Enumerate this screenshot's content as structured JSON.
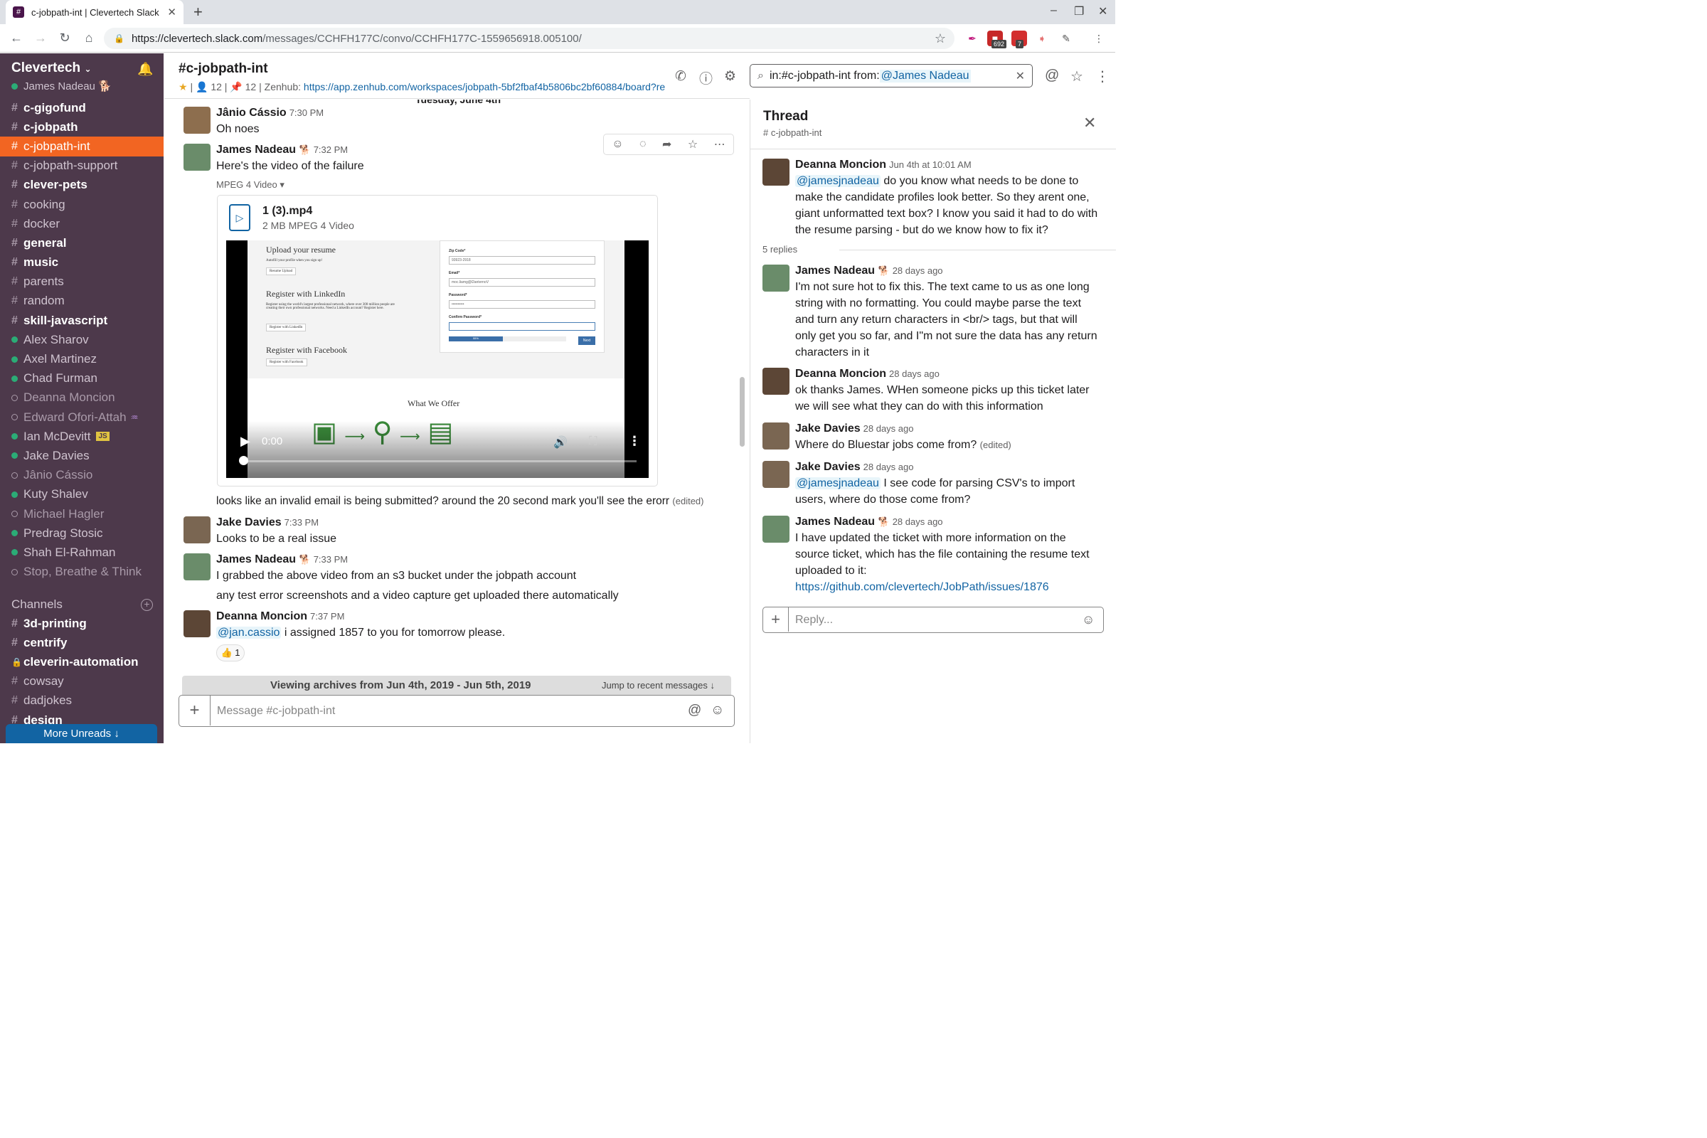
{
  "browser": {
    "tab_title": "c-jobpath-int | Clevertech Slack",
    "url_host": "https://clevertech.slack.com",
    "url_path": "/messages/CCHFH177C/convo/CCHFH177C-1559656918.005100/",
    "ext_badge_1": "692",
    "ext_badge_2": "7"
  },
  "sidebar": {
    "workspace": "Clevertech",
    "user": "James Nadeau",
    "user_emoji": "🐕",
    "items": [
      {
        "label": "c-gigofund",
        "kind": "channel",
        "style": "bold"
      },
      {
        "label": "c-jobpath",
        "kind": "channel",
        "style": "bold"
      },
      {
        "label": "c-jobpath-int",
        "kind": "channel",
        "style": "active"
      },
      {
        "label": "c-jobpath-support",
        "kind": "channel",
        "style": "normal"
      },
      {
        "label": "clever-pets",
        "kind": "channel",
        "style": "bold"
      },
      {
        "label": "cooking",
        "kind": "channel",
        "style": "normal"
      },
      {
        "label": "docker",
        "kind": "channel",
        "style": "normal"
      },
      {
        "label": "general",
        "kind": "channel",
        "style": "bold"
      },
      {
        "label": "music",
        "kind": "channel",
        "style": "bold"
      },
      {
        "label": "parents",
        "kind": "channel",
        "style": "normal"
      },
      {
        "label": "random",
        "kind": "channel",
        "style": "normal"
      },
      {
        "label": "skill-javascript",
        "kind": "channel",
        "style": "bold"
      },
      {
        "label": "Alex Sharov",
        "kind": "dm-online",
        "style": "normal"
      },
      {
        "label": "Axel Martinez",
        "kind": "dm-online",
        "style": "normal"
      },
      {
        "label": "Chad Furman",
        "kind": "dm-online",
        "style": "normal"
      },
      {
        "label": "Deanna Moncion",
        "kind": "dm-away",
        "style": "dim"
      },
      {
        "label": "Edward Ofori-Attah",
        "kind": "dm-away",
        "style": "dim"
      },
      {
        "label": "Ian McDevitt",
        "kind": "dm-online",
        "style": "normal"
      },
      {
        "label": "Jake Davies",
        "kind": "dm-online",
        "style": "normal"
      },
      {
        "label": "Jânio Cássio",
        "kind": "dm-away",
        "style": "dim"
      },
      {
        "label": "Kuty Shalev",
        "kind": "dm-online",
        "style": "normal"
      },
      {
        "label": "Michael Hagler",
        "kind": "dm-away",
        "style": "dim"
      },
      {
        "label": "Predrag Stosic",
        "kind": "dm-online",
        "style": "normal"
      },
      {
        "label": "Shah El-Rahman",
        "kind": "dm-online",
        "style": "normal"
      },
      {
        "label": "Stop, Breathe & Think",
        "kind": "dm-away",
        "style": "dim"
      }
    ],
    "ian_badge": "JS",
    "channels_header": "Channels",
    "channels": [
      {
        "label": "3d-printing",
        "locked": false
      },
      {
        "label": "centrify",
        "locked": false
      },
      {
        "label": "cleverin-automation",
        "locked": true
      },
      {
        "label": "cowsay",
        "locked": false,
        "style": "normal"
      },
      {
        "label": "dadjokes",
        "locked": false,
        "style": "normal"
      },
      {
        "label": "design",
        "locked": false
      }
    ],
    "more_unreads": "More Unreads"
  },
  "channel": {
    "title": "#c-jobpath-int",
    "members": "12",
    "pins": "12",
    "topic_prefix": "Zenhub:",
    "topic_link": "https://app.zenhub.com/workspaces/jobpath-5bf2fbaf4b5806bc2bf60884/board?re",
    "day_label": "Tuesday, June 4th"
  },
  "search": {
    "prefix": "in:#c-jobpath-int from:",
    "mention": "@James Nadeau"
  },
  "messages": {
    "m1_name": "Jânio Cássio",
    "m1_time": "7:30 PM",
    "m1_text": "Oh noes",
    "m2_name": "James Nadeau",
    "m2_emoji": "🐕",
    "m2_time": "7:32 PM",
    "m2_text": "Here's the video of the failure",
    "video_label": "MPEG 4 Video",
    "file_name": "1 (3).mp4",
    "file_meta": "2 MB MPEG 4 Video",
    "video_time": "0:00",
    "video_frame": {
      "upload": "Upload your resume",
      "upload_sub": "Autofill your profile when you sign up!",
      "upload_btn": "Resume Upload",
      "linkedin": "Register with LinkedIn",
      "linkedin_sub": "Register using the world's largest professional network, where over 300 million people are creating their own professional networks. Need a LinkedIn account? Register here.",
      "linkedin_btn": "Register with LinkedIn",
      "facebook": "Register with Facebook",
      "facebook_btn": "Register with Facebook",
      "zip_label": "Zip Code*",
      "zip_val": "93923-2918",
      "email_label": "Email*",
      "email_val": "moc.liamg@l2anternoV",
      "password_label": "Password*",
      "password_val": "••••••••••",
      "confirm_label": "Confirm Password*",
      "progress": "55%",
      "next": "Next",
      "offer": "What We Offer"
    },
    "m2_followup": "looks like an invalid email is being submitted? around the 20 second mark you'll see the erorr",
    "edited": "(edited)",
    "m3_name": "Jake Davies",
    "m3_time": "7:33 PM",
    "m3_text": "Looks to be a real issue",
    "m4_name": "James Nadeau",
    "m4_emoji": "🐕",
    "m4_time": "7:33 PM",
    "m4_text": "I grabbed the above video from an s3 bucket under the jobpath account",
    "m4_text2": "any test error screenshots and a video capture get uploaded there automatically",
    "m5_name": "Deanna Moncion",
    "m5_time": "7:37 PM",
    "m5_mention": "@jan.cassio",
    "m5_text": " i assigned 1857 to you for tomorrow please.",
    "m5_reaction_emoji": "👍",
    "m5_reaction_count": "1"
  },
  "archive": {
    "label": "Viewing archives from Jun 4th, 2019 - Jun 5th, 2019",
    "jump": "Jump to recent messages"
  },
  "composer": {
    "placeholder": "Message #c-jobpath-int"
  },
  "thread": {
    "title": "Thread",
    "channel": "# c-jobpath-int",
    "parent_name": "Deanna Moncion",
    "parent_time": "Jun 4th at 10:01 AM",
    "parent_mention": "@jamesjnadeau",
    "parent_text": " do you know what needs to be done to make the candidate profiles look better. So they arent one, giant unformatted text box?  I know you said it had to do with the resume parsing - but do we know how to fix it?",
    "replies": "5 replies",
    "r1_name": "James Nadeau",
    "r1_emoji": "🐕",
    "r1_time": "28 days ago",
    "r1_text": "I'm not sure hot to fix this. The text came to us as one long string with no formatting. You could maybe parse the text and turn any return characters in <br/> tags, but that will only get you so far, and I\"m not sure the data has any return characters in it",
    "r2_name": "Deanna Moncion",
    "r2_time": "28 days ago",
    "r2_text": "ok thanks James. WHen someone picks up this ticket later we will see what they can do with this information",
    "r3_name": "Jake Davies",
    "r3_time": "28 days ago",
    "r3_text": "Where do Bluestar jobs come from?",
    "r3_edited": "(edited)",
    "r4_name": "Jake Davies",
    "r4_time": "28 days ago",
    "r4_mention": "@jamesjnadeau",
    "r4_text": " I see code for parsing CSV's to import users, where do those come from?",
    "r5_name": "James Nadeau",
    "r5_emoji": "🐕",
    "r5_time": "28 days ago",
    "r5_text": "I have updated the ticket with more information on the source ticket, which has the file containing the resume text uploaded to it:",
    "r5_link": "https://github.com/clevertech/JobPath/issues/1876",
    "reply_placeholder": "Reply..."
  },
  "colors": {
    "sidebar_bg": "#4d394b",
    "active_channel": "#f26522",
    "link": "#1264a3",
    "online": "#2bac76"
  }
}
